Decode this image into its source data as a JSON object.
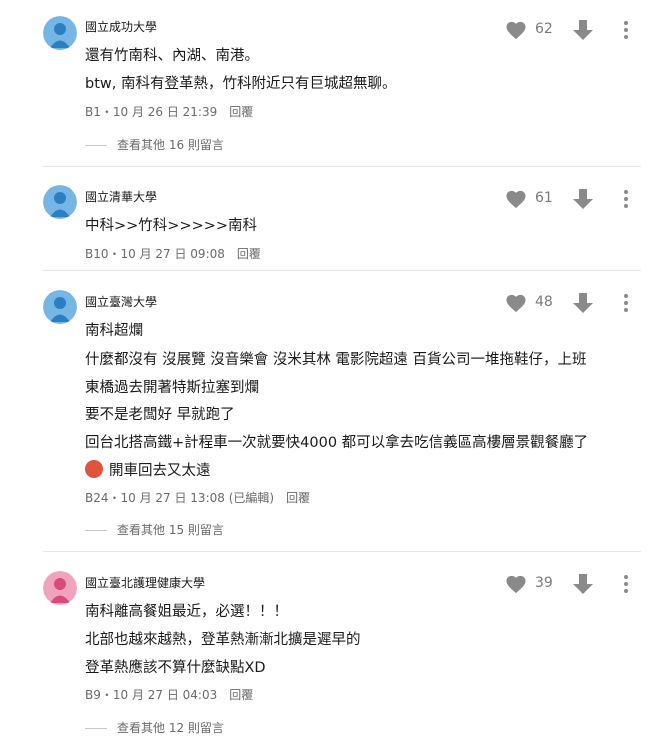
{
  "icons": {
    "like": "heart-icon",
    "dislike": "down-arrow-icon",
    "more": "more-vertical-icon",
    "emoji": "angry-face-emoji"
  },
  "colors": {
    "avatar_blue": "#76b6e5",
    "avatar_pink": "#f0a3bd",
    "icon_gray": "#8a8a8a"
  },
  "comments": [
    {
      "school": "國立成功大學",
      "lines": [
        "還有竹南科、內湖、南港。",
        "btw, 南科有登革熱，竹科附近只有巨城超無聊。"
      ],
      "likes": "62",
      "meta": "B1・10 月 26 日 21:39",
      "reply": "回覆",
      "more_replies": "查看其他 16 則留言"
    },
    {
      "school": "國立清華大學",
      "lines": [
        "中科>>竹科>>>>>南科"
      ],
      "likes": "61",
      "meta": "B10・10 月 27 日 09:08",
      "reply": "回覆"
    },
    {
      "school": "國立臺灣大學",
      "lines": [
        "南科超爛",
        "什麼都沒有 沒展覽 沒音樂會 沒米其林 電影院超遠 百貨公司一堆拖鞋仔，上班",
        "東橋過去開著特斯拉塞到爛",
        "要不是老闆好 早就跑了",
        "回台北搭高鐵+計程車一次就要快4000 都可以拿去吃信義區高樓層景觀餐廳了",
        "開車回去又太遠"
      ],
      "likes": "48",
      "meta": "B24・10 月 27 日 13:08 (已編輯)",
      "reply": "回覆",
      "more_replies": "查看其他 15 則留言"
    },
    {
      "school": "國立臺北護理健康大學",
      "lines": [
        "南科離高餐姐最近，必選！！！",
        "北部也越來越熱，登革熱漸漸北擴是遲早的",
        "登革熱應該不算什麼缺點XD"
      ],
      "likes": "39",
      "meta": "B9・10 月 27 日 04:03",
      "reply": "回覆",
      "more_replies": "查看其他 12 則留言"
    }
  ]
}
